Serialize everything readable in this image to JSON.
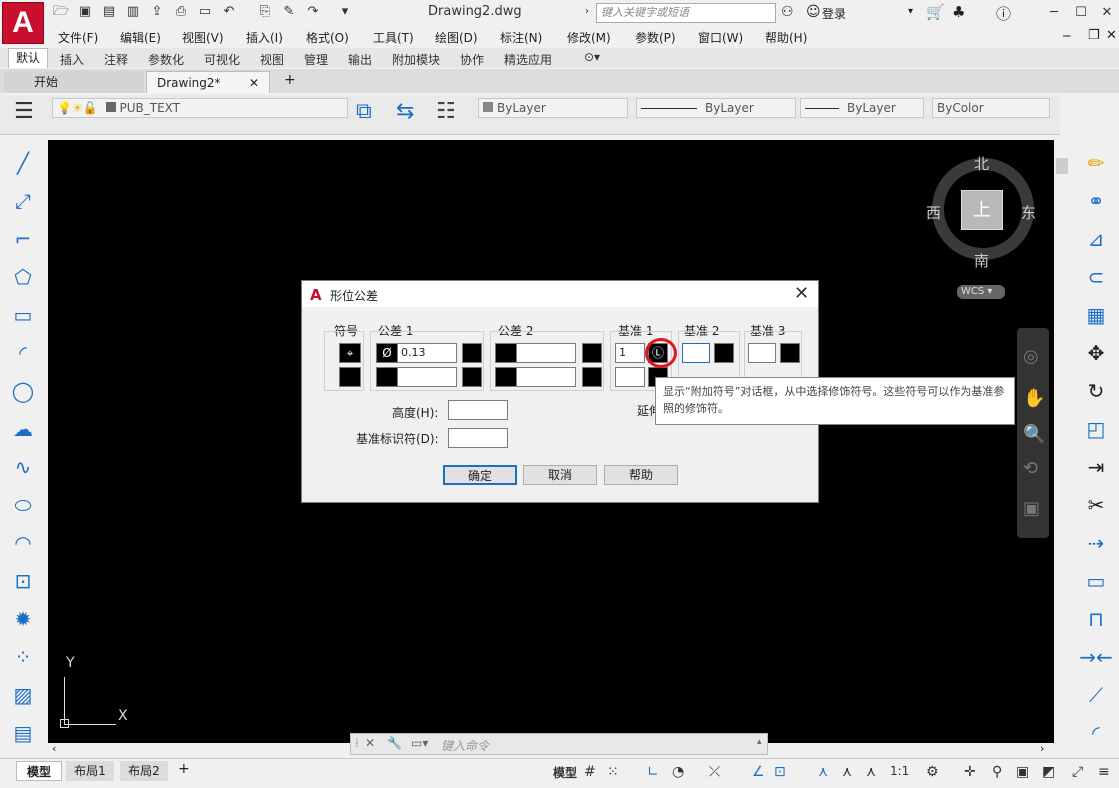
{
  "window": {
    "title": "Drawing2.dwg",
    "search_placeholder": "键入关键字或短语",
    "login": "登录"
  },
  "app_button": "A",
  "menu": [
    "文件(F)",
    "编辑(E)",
    "视图(V)",
    "插入(I)",
    "格式(O)",
    "工具(T)",
    "绘图(D)",
    "标注(N)",
    "修改(M)",
    "参数(P)",
    "窗口(W)",
    "帮助(H)"
  ],
  "ribbon_tabs": [
    "默认",
    "插入",
    "注释",
    "参数化",
    "可视化",
    "视图",
    "管理",
    "输出",
    "附加模块",
    "协作",
    "精选应用"
  ],
  "file_tabs": {
    "start": "开始",
    "drawing": "Drawing2*",
    "add": "+"
  },
  "toolbar": {
    "layer": "PUB_TEXT",
    "color": "ByLayer",
    "linetype": "ByLayer",
    "lineweight": "ByLayer",
    "plotstyle": "ByColor"
  },
  "viewcube": {
    "north": "北",
    "south": "南",
    "west": "西",
    "east": "东",
    "face": "上",
    "wcs": "WCS"
  },
  "ucs": {
    "y": "Y",
    "x": "X"
  },
  "command": {
    "placeholder": "键入命令"
  },
  "layout_tabs": [
    "模型",
    "布局1",
    "布局2"
  ],
  "status": {
    "model": "模型",
    "scale": "1:1"
  },
  "dialog": {
    "title": "形位公差",
    "symbol_label": "符号",
    "tol1_label": "公差 1",
    "tol2_label": "公差 2",
    "datum1_label": "基准 1",
    "datum2_label": "基准 2",
    "datum3_label": "基准 3",
    "tol1_value": "0.13",
    "diameter": "Ø",
    "datum1_value": "1",
    "height_label": "高度(H):",
    "datum_id_label": "基准标识符(D):",
    "projected_label": "延伸",
    "ok": "确定",
    "cancel": "取消",
    "help": "帮助"
  },
  "tooltip": "显示“附加符号”对话框，从中选择修饰符号。这些符号可以作为基准参照的修饰符。"
}
